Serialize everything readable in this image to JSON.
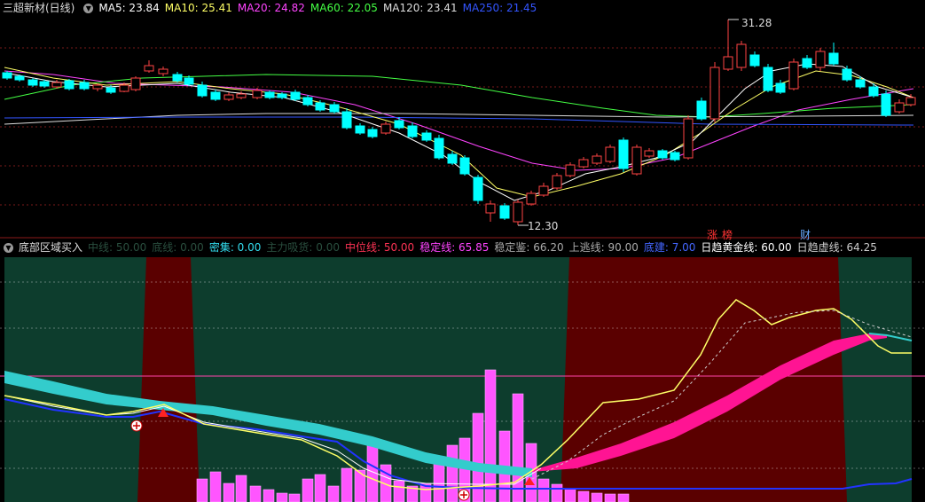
{
  "header": {
    "title": "三超新材(日线)",
    "ma": [
      {
        "label": "MA5: 23.84",
        "color": "#ffffff"
      },
      {
        "label": "MA10: 25.41",
        "color": "#ffff66"
      },
      {
        "label": "MA20: 24.82",
        "color": "#ff44ff"
      },
      {
        "label": "MA60: 22.05",
        "color": "#44ff44"
      },
      {
        "label": "MA120: 23.41",
        "color": "#dddddd"
      },
      {
        "label": "MA250: 21.45",
        "color": "#3355ff"
      }
    ]
  },
  "price_chart": {
    "high_label": "31.28",
    "low_label": "12.30",
    "badges": [
      {
        "text": "涨",
        "color": "#ff3333"
      },
      {
        "text": "榜",
        "color": "#ff3333"
      },
      {
        "text": "财",
        "color": "#66aaff"
      }
    ]
  },
  "indicator": {
    "title": "底部区域买入",
    "params": [
      {
        "label": "中线: 50.00",
        "color": "#2a4f3f"
      },
      {
        "label": "底线: 0.00",
        "color": "#2a4f3f"
      },
      {
        "label": "密集: 0.00",
        "color": "#33ddee"
      },
      {
        "label": "主力吸货: 0.00",
        "color": "#2a4f3f"
      },
      {
        "label": "中位线: 50.00",
        "color": "#ff3355"
      },
      {
        "label": "稳定线: 65.85",
        "color": "#ff44ff"
      },
      {
        "label": "稳定鉴: 66.20",
        "color": "#aaaaaa"
      },
      {
        "label": "上逃线: 90.00",
        "color": "#aaaaaa"
      },
      {
        "label": "底建: 7.00",
        "color": "#4466ff"
      },
      {
        "label": "日趋黄金线: 60.00",
        "color": "#ffffff"
      },
      {
        "label": "日趋虚线: 64.25",
        "color": "#cccccc"
      }
    ]
  },
  "colors": {
    "up": "#ff4444",
    "down": "#00ffff",
    "zone_green": "#0d3d2d",
    "zone_red": "#5a0000",
    "histogram": "#ff55ff",
    "band_cyan": "#33cccc",
    "band_pink": "#ff1493"
  }
}
